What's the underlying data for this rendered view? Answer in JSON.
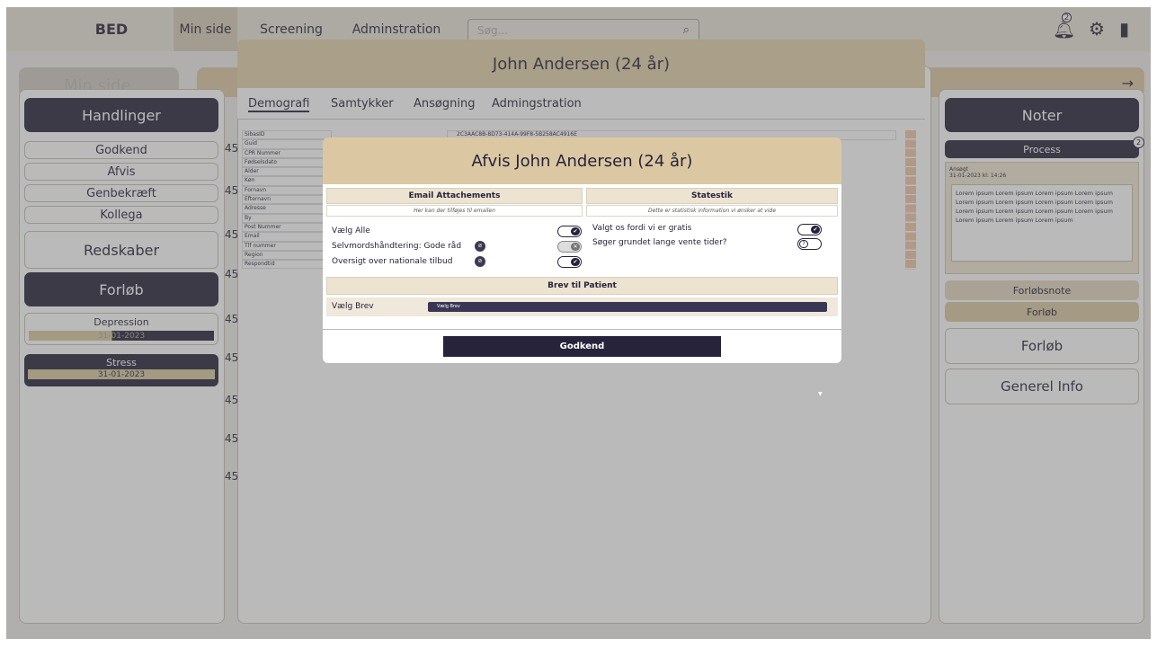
{
  "nav": {
    "brand": "BED",
    "tabs": [
      "Min side",
      "Screening",
      "Adminstration"
    ],
    "search_placeholder": "Søg...",
    "notification_count": "2"
  },
  "page": {
    "title": "Min side",
    "back_title": "John Andersen (24 år)",
    "header_arrow": "→"
  },
  "left": {
    "actions_title": "Handlinger",
    "actions": [
      "Godkend",
      "Afvis",
      "Genbekræft",
      "Kollega"
    ],
    "tools_title": "Redskaber",
    "course_title": "Forløb",
    "courses": [
      {
        "name": "Depression",
        "date": "31-01-2023"
      },
      {
        "name": "Stress",
        "date": "31-01-2023"
      }
    ]
  },
  "center": {
    "row_numbers": [
      "45",
      "45",
      "45",
      "45",
      "45",
      "45",
      "45",
      "45",
      "45"
    ],
    "tabs": [
      "Demografi",
      "Samtykker",
      "Ansøgning",
      "Admingstration"
    ],
    "fields": [
      "SibasID",
      "Guid",
      "CPR Nummer",
      "Fødselsdato",
      "Alder",
      "Køn",
      "Fornavn",
      "Efternavn",
      "Adresse",
      "By",
      "Post Nummer",
      "Email",
      "Tlf nummer",
      "Region",
      "Respondtid"
    ],
    "sibas_value": "2C3AAC8B-8D73-414A-99F8-5B258AC4916E"
  },
  "right": {
    "notes_title": "Noter",
    "process_label": "Process",
    "process_badge": "2",
    "note_meta": "Ansøgt",
    "note_date": "31-01-2023 kl: 14:26",
    "note_text": "Lorem ipsum Lorem ipsum Lorem ipsum Lorem ipsum Lorem ipsum Lorem ipsum Lorem ipsum Lorem ipsum Lorem ipsum Lorem ipsum Lorem ipsum Lorem ipsum Lorem ipsum Lorem ipsum Lorem ipsum",
    "forlobsnote": "Forløbsnote",
    "forlob_tab": "Forløb",
    "forlob_btn": "Forløb",
    "general_btn": "Generel Info"
  },
  "modal": {
    "title": "Afvis John Andersen (24 år)",
    "email_title": "Email Attachements",
    "email_hint": "Her kan der tilføjes til emailen",
    "stats_title": "Statestik",
    "stats_hint": "Dette er statistisk information vi ønsker at vide",
    "email_rows": [
      {
        "label": "Vælg Alle",
        "state": "on"
      },
      {
        "label": "Selvmordshåndtering: Gode råd",
        "state": "x"
      },
      {
        "label": "Oversigt over nationale tilbud",
        "state": "on"
      }
    ],
    "stats_rows": [
      {
        "label": "Valgt os fordi vi er gratis",
        "state": "on"
      },
      {
        "label": "Søger grundet lange vente tider?",
        "state": "?"
      }
    ],
    "letter_title": "Brev til Patient",
    "letter_label": "Vælg Brev",
    "letter_select": "Vælg Brev",
    "approve": "Godkend"
  },
  "colors": {
    "dark": "#26233a",
    "beige": "#dbc8a3",
    "background": "#f0ede8"
  }
}
